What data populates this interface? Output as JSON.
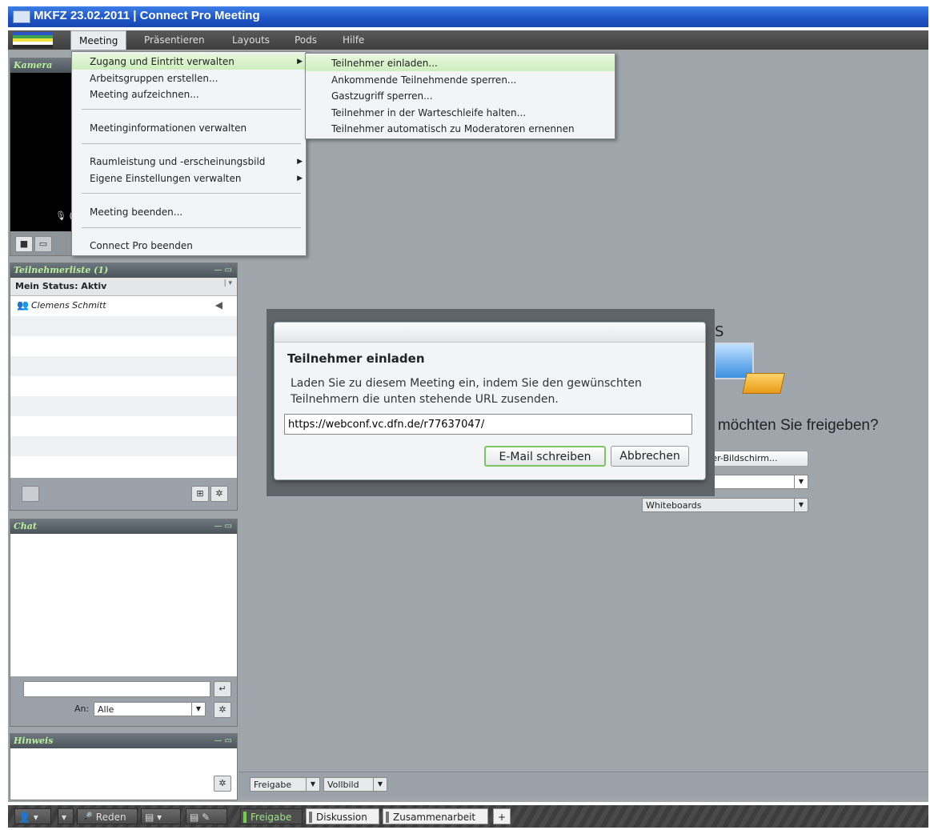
{
  "window": {
    "title": "MKFZ 23.02.2011  |  Connect Pro Meeting"
  },
  "menubar": {
    "items": [
      "Meeting",
      "Präsentieren",
      "Layouts",
      "Pods",
      "Hilfe"
    ]
  },
  "meeting_menu": {
    "items": [
      "Zugang und Eintritt verwalten",
      "Arbeitsgruppen erstellen...",
      "Meeting aufzeichnen...",
      "Meetinginformationen verwalten",
      "Raumleistung und -erscheinungsbild",
      "Eigene Einstellungen verwalten",
      "Meeting beenden...",
      "Connect Pro beenden"
    ]
  },
  "submenu": {
    "items": [
      "Teilnehmer einladen...",
      "Ankommende Teilnehmende sperren...",
      "Gastzugriff sperren...",
      "Teilnehmer in der Warteschleife halten...",
      "Teilnehmer automatisch zu Moderatoren ernennen"
    ]
  },
  "camera_pod": {
    "title": "Kamera",
    "mic_text": "🎙 ("
  },
  "attendee_pod": {
    "title": "Teilnehmerliste (1)",
    "status": "Mein Status: Aktiv",
    "attendees": [
      "Clemens Schmitt"
    ]
  },
  "chat_pod": {
    "title": "Chat",
    "to_label": "An:",
    "to_value": "Alle",
    "input_value": ""
  },
  "notes_pod": {
    "title": "Hinweis"
  },
  "share_pod": {
    "question": "möchten Sie freigeben?",
    "heading_fragment": "S",
    "option_screen": "ter-Bildschirm...",
    "option_whiteboards": "Whiteboards",
    "footer_share": "Freigabe",
    "footer_fullscreen": "Vollbild"
  },
  "dialog": {
    "title": "Teilnehmer einladen",
    "message_line1": "Laden Sie zu diesem Meeting ein, indem Sie den gewünschten",
    "message_line2": "Teilnehmern die unten stehende URL zusenden.",
    "url": "https://webconf.vc.dfn.de/r77637047/",
    "email_button": "E-Mail schreiben",
    "cancel_button": "Abbrechen"
  },
  "bottombar": {
    "speak": "Reden",
    "tabs": [
      "Freigabe",
      "Diskussion",
      "Zusammenarbeit"
    ],
    "add": "+"
  },
  "colors": {
    "accent_green": "#b9f09a",
    "titlebar_blue": "#2a62d4",
    "highlight": "#cdeebd"
  }
}
